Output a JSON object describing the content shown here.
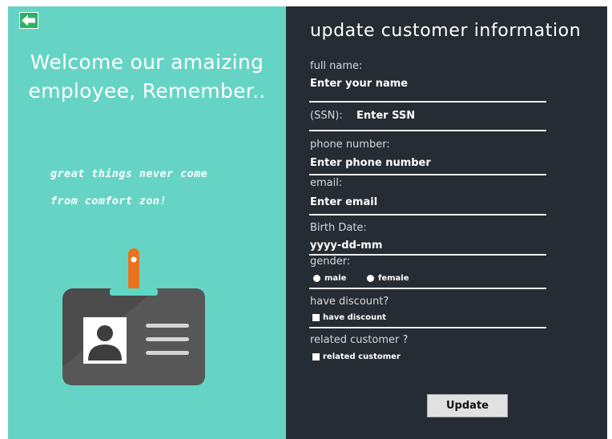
{
  "left": {
    "welcome_line1": "Welcome our amaizing",
    "welcome_line2": "employee, Remember..",
    "quote_line1": "great things never come",
    "quote_line2": "from comfort zon!",
    "back_icon": "back-arrow-icon",
    "badge_icon": "id-badge-icon"
  },
  "form": {
    "title": "update customer information",
    "full_name_label": "full name:",
    "full_name_value": "Enter your name",
    "ssn_label": "(SSN):",
    "ssn_value": "Enter SSN",
    "phone_label": "phone number:",
    "phone_value": "Enter phone number",
    "email_label": "email:",
    "email_value": "Enter  email",
    "birth_label": "Birth Date:",
    "birth_value": "yyyy-dd-mm",
    "gender_label": "gender:",
    "gender_options": [
      "male",
      "female"
    ],
    "discount_label": "have discount?",
    "discount_option": "have discount",
    "related_label": "related customer ?",
    "related_option": "related customer",
    "update_button": "Update"
  },
  "colors": {
    "left_panel_bg": "#66d4c5",
    "right_panel_bg": "#252c33",
    "badge_body": "#4b4b4b",
    "badge_strap": "#e8731f",
    "badge_clip": "#5ed8c4"
  }
}
